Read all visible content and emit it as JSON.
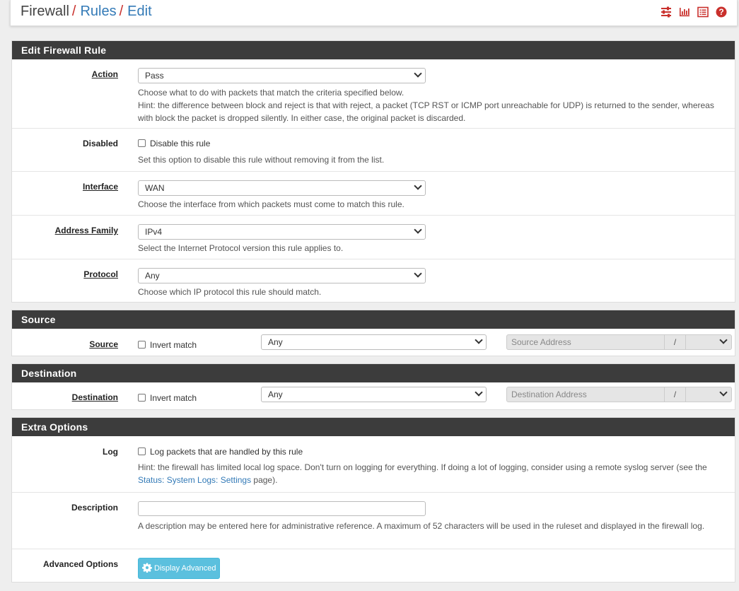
{
  "breadcrumb": {
    "root": "Firewall",
    "rules": "Rules",
    "edit": "Edit"
  },
  "separator": "/",
  "icons": [
    "sliders-icon",
    "bar-chart-icon",
    "list-icon",
    "help-icon"
  ],
  "colors": {
    "heading_bg": "#3c3c3c",
    "link": "#337ab7",
    "accent_red": "#c9302c",
    "button_info": "#5bc0de"
  },
  "edit_rule": {
    "heading": "Edit Firewall Rule",
    "action": {
      "label": "Action",
      "value": "Pass",
      "help1": "Choose what to do with packets that match the criteria specified below.",
      "help2": "Hint: the difference between block and reject is that with reject, a packet (TCP RST or ICMP port unreachable for UDP) is returned to the sender, whereas with block the packet is dropped silently. In either case, the original packet is discarded."
    },
    "disabled": {
      "label": "Disabled",
      "checkbox_label": "Disable this rule",
      "help": "Set this option to disable this rule without removing it from the list."
    },
    "interface": {
      "label": "Interface",
      "value": "WAN",
      "help": "Choose the interface from which packets must come to match this rule."
    },
    "address_family": {
      "label": "Address Family",
      "value": "IPv4",
      "help": "Select the Internet Protocol version this rule applies to."
    },
    "protocol": {
      "label": "Protocol",
      "value": "Any",
      "help": "Choose which IP protocol this rule should match."
    }
  },
  "source": {
    "heading": "Source",
    "label": "Source",
    "invert_label": "Invert match",
    "type_value": "Any",
    "address_placeholder": "Source Address",
    "slash": "/"
  },
  "destination": {
    "heading": "Destination",
    "label": "Destination",
    "invert_label": "Invert match",
    "type_value": "Any",
    "address_placeholder": "Destination Address",
    "slash": "/"
  },
  "extra": {
    "heading": "Extra Options",
    "log": {
      "label": "Log",
      "checkbox_label": "Log packets that are handled by this rule",
      "help_prefix": "Hint: the firewall has limited local log space. Don't turn on logging for everything. If doing a lot of logging, consider using a remote syslog server (see the ",
      "help_link": "Status: System Logs: Settings",
      "help_suffix": " page)."
    },
    "description": {
      "label": "Description",
      "value": "",
      "help": "A description may be entered here for administrative reference. A maximum of 52 characters will be used in the ruleset and displayed in the firewall log."
    },
    "advanced": {
      "label": "Advanced Options",
      "button": "Display Advanced"
    }
  }
}
